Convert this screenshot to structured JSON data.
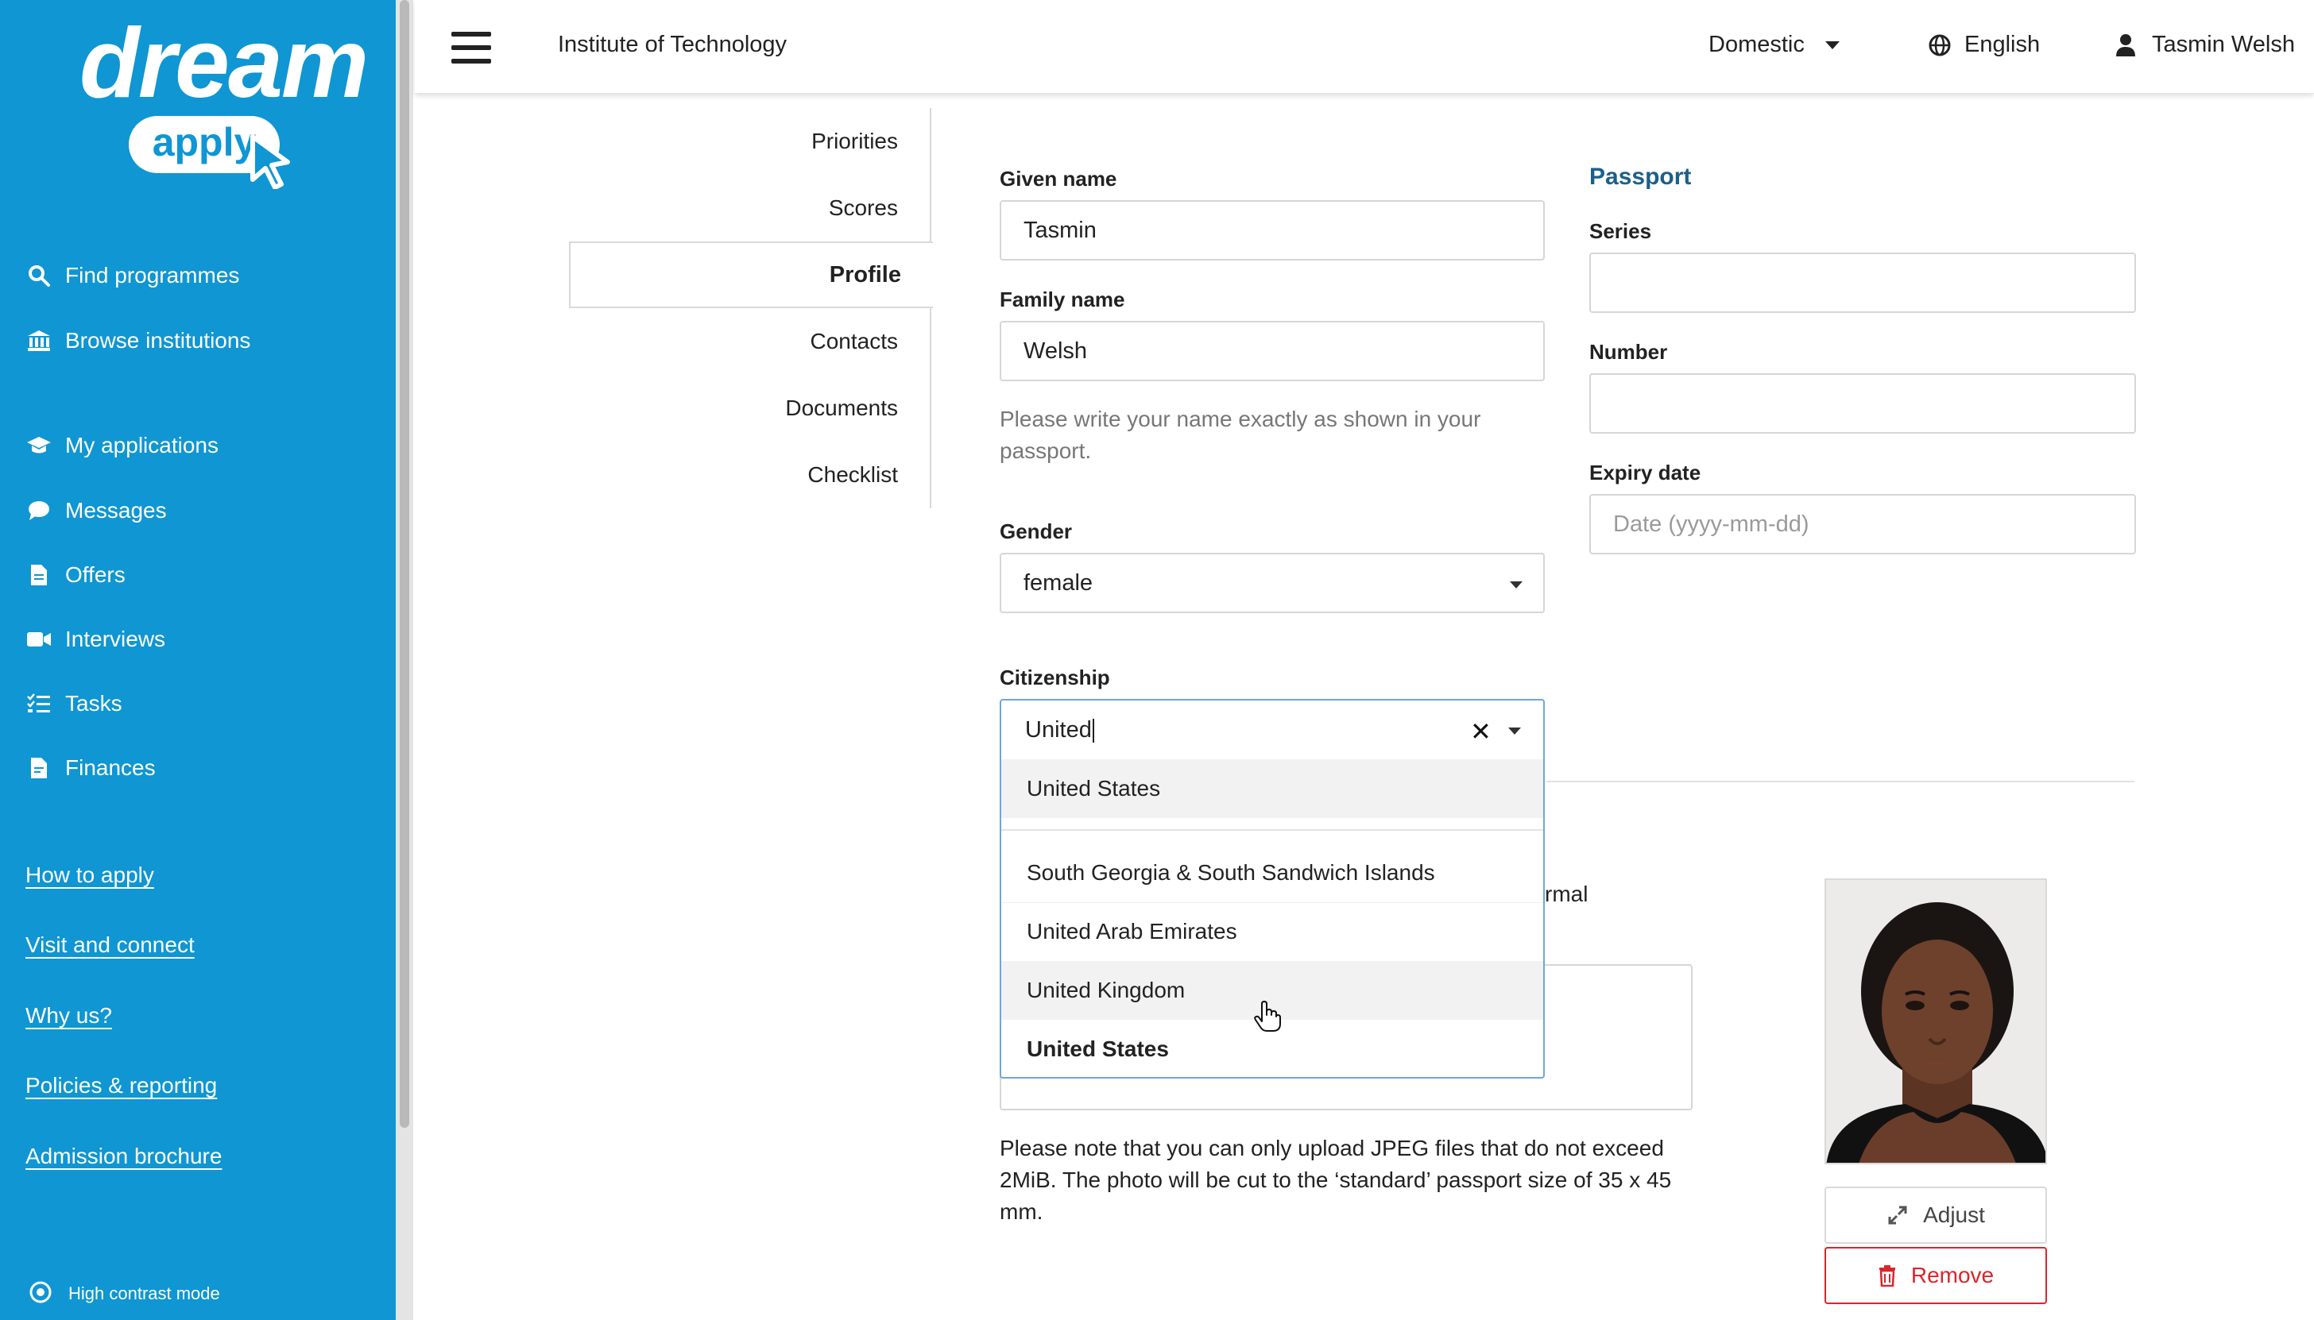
{
  "sidebar": {
    "logo_word": "dream",
    "logo_sub": "apply",
    "nav_primary": [
      {
        "label": "Find programmes",
        "icon": "search-icon"
      },
      {
        "label": "Browse institutions",
        "icon": "institution-icon"
      }
    ],
    "nav_secondary": [
      {
        "label": "My applications",
        "icon": "graduation-cap-icon"
      },
      {
        "label": "Messages",
        "icon": "chat-bubble-icon"
      },
      {
        "label": "Offers",
        "icon": "document-icon"
      },
      {
        "label": "Interviews",
        "icon": "video-camera-icon"
      },
      {
        "label": "Tasks",
        "icon": "checklist-icon"
      },
      {
        "label": "Finances",
        "icon": "invoice-icon"
      }
    ],
    "links": [
      "How to apply",
      "Visit and connect",
      "Why us?",
      "Policies & reporting",
      "Admission brochure"
    ],
    "high_contrast": "High contrast mode",
    "colors": {
      "background": "#0f96d3"
    }
  },
  "topbar": {
    "institution": "Institute of Technology",
    "domestic": "Domestic",
    "language": "English",
    "user": "Tasmin Welsh"
  },
  "tabs": {
    "items": [
      "Priorities",
      "Scores",
      "Profile",
      "Contacts",
      "Documents",
      "Checklist"
    ],
    "active": "Profile"
  },
  "form": {
    "given_name_label": "Given name",
    "given_name_value": "Tasmin",
    "family_name_label": "Family name",
    "family_name_value": "Welsh",
    "name_help": "Please write your name exactly as shown in your passport.",
    "gender_label": "Gender",
    "gender_value": "female",
    "citizenship_label": "Citizenship",
    "citizenship_query": "United",
    "citizenship_options": [
      "United States",
      "South Georgia & South Sandwich Islands",
      "United Arab Emirates",
      "United Kingdom",
      "United States"
    ],
    "hidden_fragment": "rmal",
    "photo_note": "Please note that you can only upload JPEG files that do not exceed 2MiB. The photo will be cut to the ‘standard’ passport size of 35 x 45 mm."
  },
  "passport": {
    "heading": "Passport",
    "series_label": "Series",
    "series_value": "",
    "number_label": "Number",
    "number_value": "",
    "expiry_label": "Expiry date",
    "expiry_placeholder": "Date (yyyy-mm-dd)"
  },
  "photo": {
    "adjust_label": "Adjust",
    "remove_label": "Remove",
    "colors": {
      "remove": "#d9262c"
    }
  }
}
